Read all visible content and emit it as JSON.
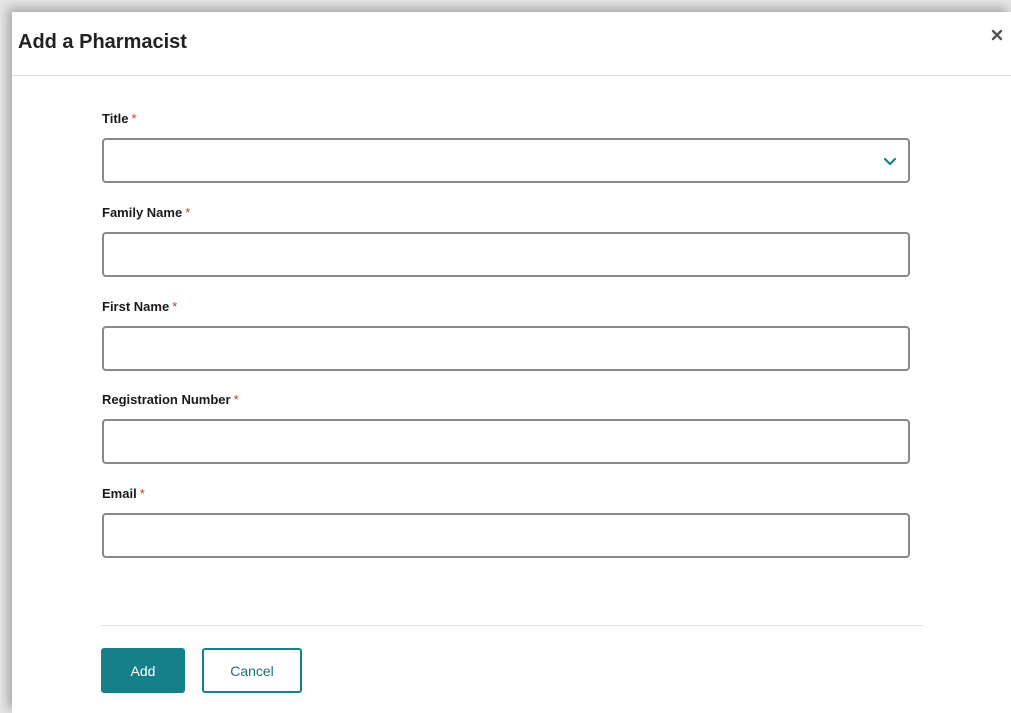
{
  "dialog": {
    "title": "Add a Pharmacist",
    "close_icon": "close-icon"
  },
  "form": {
    "required_marker": "*",
    "title_field": {
      "label": "Title",
      "value": "",
      "icon": "chevron-down-icon"
    },
    "family_name": {
      "label": "Family Name",
      "value": ""
    },
    "first_name": {
      "label": "First Name",
      "value": ""
    },
    "registration_number": {
      "label": "Registration Number",
      "value": ""
    },
    "email": {
      "label": "Email",
      "value": ""
    }
  },
  "actions": {
    "add_label": "Add",
    "cancel_label": "Cancel"
  },
  "colors": {
    "accent": "#16808a",
    "required": "#c0392b",
    "border": "#8a8a8a"
  }
}
